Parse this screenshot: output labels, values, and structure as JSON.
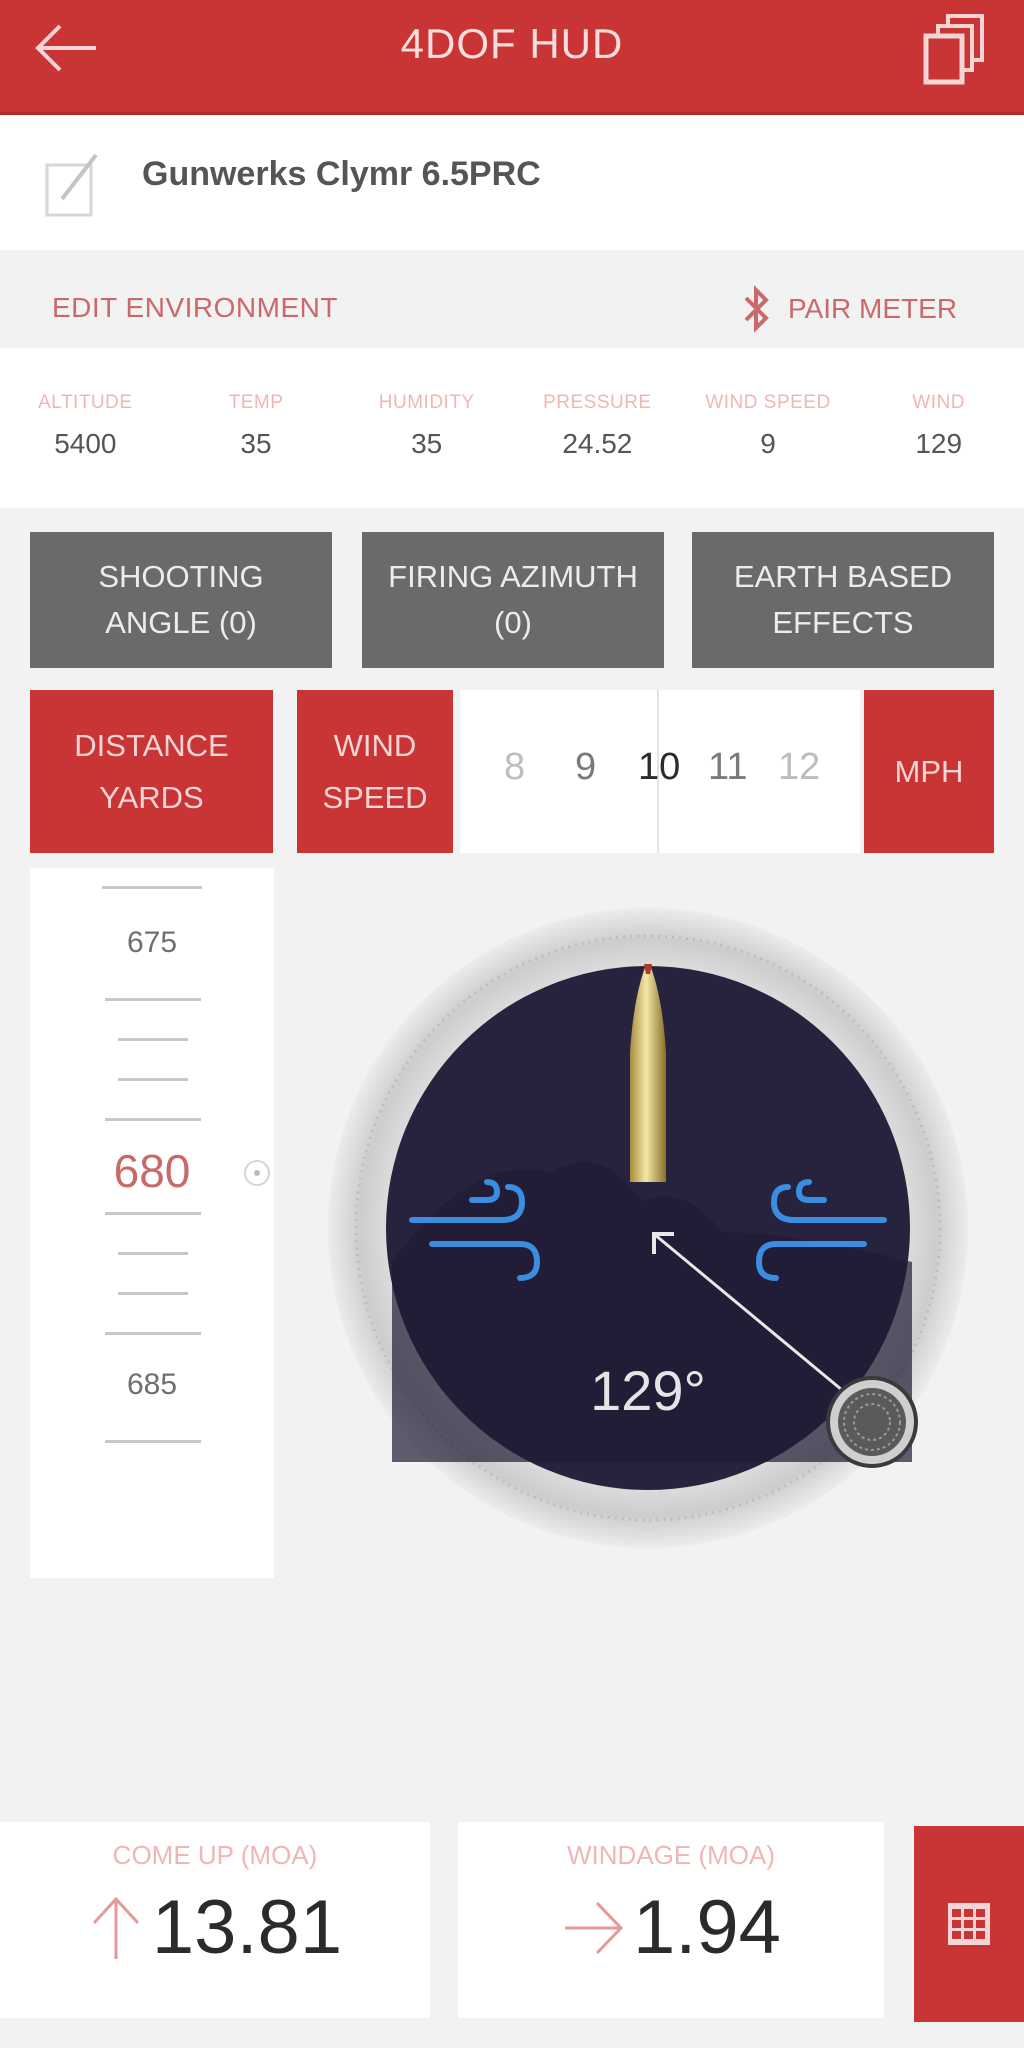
{
  "header": {
    "title": "4DOF HUD",
    "back_icon": "arrow-left-icon",
    "windows_icon": "stacked-windows-icon"
  },
  "rifle": {
    "name": "Gunwerks Clymr 6.5PRC",
    "icon": "edit-checkbox-icon"
  },
  "environment_bar": {
    "edit_label": "EDIT ENVIRONMENT",
    "pair_label": "PAIR METER",
    "pair_icon": "bluetooth-icon"
  },
  "environment": [
    {
      "label": "ALTITUDE",
      "value": "5400"
    },
    {
      "label": "TEMP",
      "value": "35"
    },
    {
      "label": "HUMIDITY",
      "value": "35"
    },
    {
      "label": "PRESSURE",
      "value": "24.52"
    },
    {
      "label": "WIND SPEED",
      "value": "9"
    },
    {
      "label": "WIND",
      "value": "129"
    }
  ],
  "options": {
    "shooting_angle": {
      "line1": "SHOOTING",
      "line2": "ANGLE (0)"
    },
    "firing_azimuth": {
      "line1": "FIRING AZIMUTH",
      "line2": "(0)"
    },
    "earth_effects": {
      "line1": "EARTH BASED",
      "line2": "EFFECTS"
    }
  },
  "distance_button": {
    "line1": "DISTANCE",
    "line2": "YARDS"
  },
  "wind_speed_button": {
    "line1": "WIND",
    "line2": "SPEED"
  },
  "wind_speed_picker": {
    "options": [
      "8",
      "9",
      "10",
      "11",
      "12"
    ],
    "selected": "10"
  },
  "unit_button": "MPH",
  "distance_picker": {
    "above": "675",
    "selected": "680",
    "below": "685"
  },
  "gauge": {
    "wind_direction_label": "129°",
    "wind_direction_deg": 129,
    "left_icon": "wind-icon",
    "right_icon": "wind-icon",
    "bullet_icon": "bullet-icon",
    "knob_icon": "dial-knob-icon"
  },
  "results": {
    "come_up": {
      "label": "COME UP (MOA)",
      "value": "13.81",
      "icon": "arrow-up-icon"
    },
    "windage": {
      "label": "WINDAGE (MOA)",
      "value": "1.94",
      "icon": "arrow-right-icon"
    },
    "table_icon": "grid-table-icon"
  },
  "colors": {
    "accent": "#c93434",
    "button_gray": "#6a6a6a",
    "wind_blue": "#3a8de0",
    "gauge_face": "#27233f"
  }
}
